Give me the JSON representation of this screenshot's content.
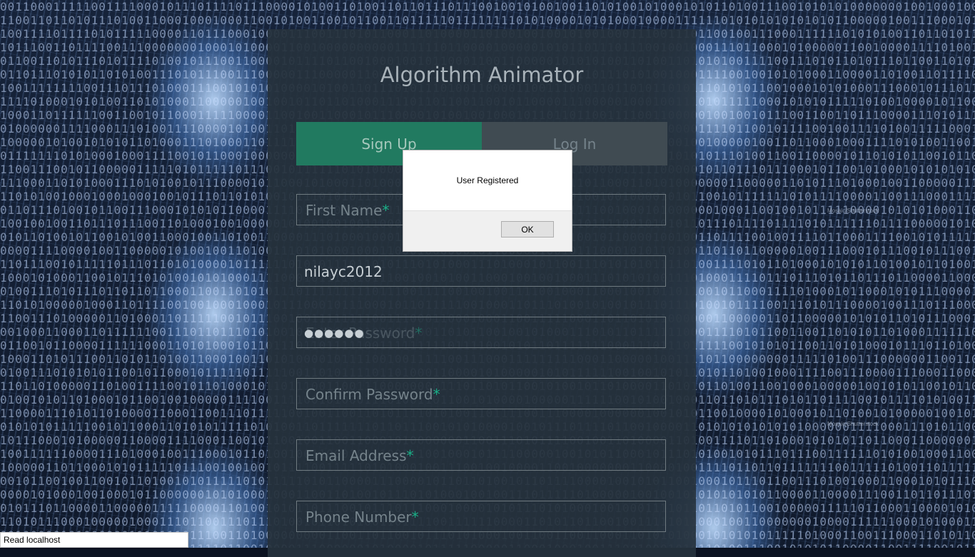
{
  "page": {
    "title": "Algorithm Animator",
    "watermark": "Mosaic/Shutterstock"
  },
  "tabs": {
    "signup": "Sign Up",
    "login": "Log In"
  },
  "form": {
    "required_mark": "*",
    "first_name_placeholder": "First Name",
    "username_value": "nilayc2012",
    "password_value": "●●●●●●",
    "password_placeholder": "Enter Password",
    "confirm_password_placeholder": "Confirm Password",
    "email_placeholder": "Email Address",
    "phone_placeholder": "Phone Number"
  },
  "dialog": {
    "message": "User Registered",
    "ok_label": "OK"
  },
  "status_bar": {
    "text": "Read localhost"
  },
  "colors": {
    "accent": "#1ab188",
    "signup_tab": "#217a60",
    "panel": "#26323c"
  }
}
